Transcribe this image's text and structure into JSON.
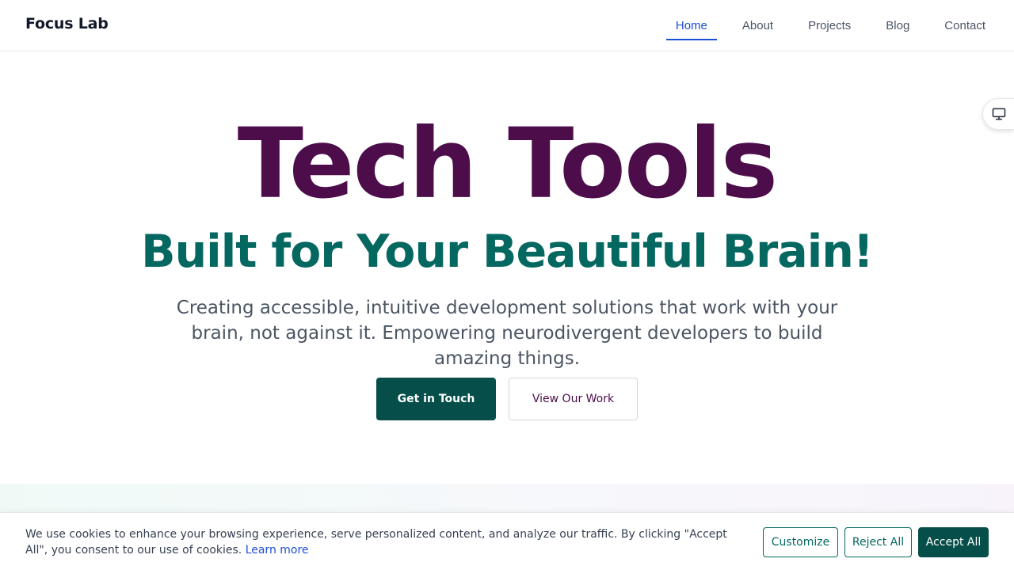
{
  "header": {
    "brand": "Focus Lab",
    "nav": [
      {
        "label": "Home",
        "active": true
      },
      {
        "label": "About",
        "active": false
      },
      {
        "label": "Projects",
        "active": false
      },
      {
        "label": "Blog",
        "active": false
      },
      {
        "label": "Contact",
        "active": false
      }
    ]
  },
  "display_toggle": {
    "icon": "monitor-icon"
  },
  "hero": {
    "title": "Tech Tools",
    "subtitle": "Built for Your Beautiful Brain!",
    "description": "Creating accessible, intuitive development solutions that work with your brain, not against it. Empowering neurodivergent developers to build amazing things.",
    "primary_button": "Get in Touch",
    "secondary_button": "View Our Work"
  },
  "cookie_banner": {
    "text": "We use cookies to enhance your browsing experience, serve personalized content, and analyze our traffic. By clicking \"Accept All\", you consent to our use of cookies.",
    "learn_more": "Learn more",
    "customize": "Customize",
    "reject_all": "Reject All",
    "accept_all": "Accept All"
  },
  "colors": {
    "title_purple": "#4c0d4a",
    "subtitle_teal": "#046861",
    "primary_button_bg": "#064e49",
    "link_blue": "#1d4ed8"
  }
}
